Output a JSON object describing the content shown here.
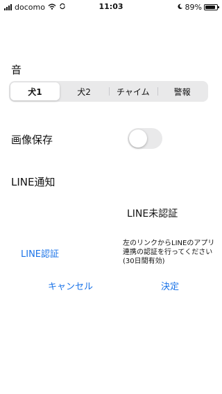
{
  "status_bar": {
    "carrier": "docomo",
    "time": "11:03",
    "battery_percent": "89%",
    "battery_level": 0.89
  },
  "sound": {
    "label": "音",
    "options": [
      "犬1",
      "犬2",
      "チャイム",
      "警報"
    ],
    "selected_index": 0
  },
  "image_save": {
    "label": "画像保存",
    "enabled": false
  },
  "line_notify": {
    "label": "LINE通知",
    "status": "LINE未認証",
    "auth_button": "LINE認証",
    "instructions": "左のリンクからLINEのアプリ連携の認証を行ってください(30日間有効)"
  },
  "actions": {
    "cancel": "キャンセル",
    "confirm": "決定"
  },
  "colors": {
    "accent": "#1a73e8",
    "segment_bg": "#e9e9ea"
  }
}
